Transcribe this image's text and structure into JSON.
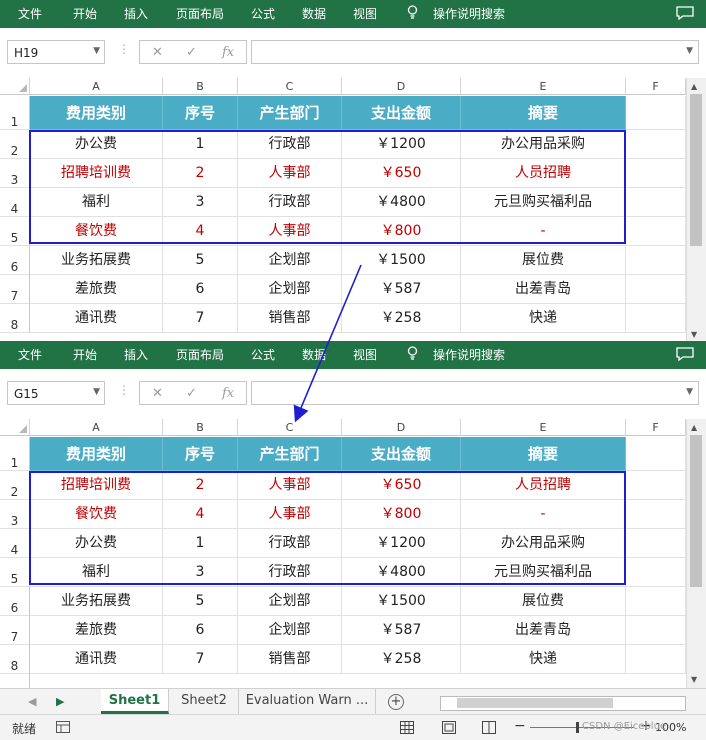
{
  "ribbon": {
    "menu": [
      "文件",
      "开始",
      "插入",
      "页面布局",
      "公式",
      "数据",
      "视图"
    ],
    "tell_me": "操作说明搜索"
  },
  "top_pane": {
    "namebox": "H19",
    "rows": [
      {
        "n": "2",
        "cells": [
          "办公费",
          "1",
          "行政部",
          "￥1200",
          "办公用品采购"
        ],
        "highlight": false
      },
      {
        "n": "3",
        "cells": [
          "招聘培训费",
          "2",
          "人事部",
          "￥650",
          "人员招聘"
        ],
        "highlight": true
      },
      {
        "n": "4",
        "cells": [
          "福利",
          "3",
          "行政部",
          "￥4800",
          "元旦购买福利品"
        ],
        "highlight": false
      },
      {
        "n": "5",
        "cells": [
          "餐饮费",
          "4",
          "人事部",
          "￥800",
          "-"
        ],
        "highlight": true
      },
      {
        "n": "6",
        "cells": [
          "业务拓展费",
          "5",
          "企划部",
          "￥1500",
          "展位费"
        ],
        "highlight": false
      },
      {
        "n": "7",
        "cells": [
          "差旅费",
          "6",
          "企划部",
          "￥587",
          "出差青岛"
        ],
        "highlight": false
      },
      {
        "n": "8",
        "cells": [
          "通讯费",
          "7",
          "销售部",
          "￥258",
          "快递"
        ],
        "highlight": false
      }
    ]
  },
  "bottom_pane": {
    "namebox": "G15",
    "rows": [
      {
        "n": "2",
        "cells": [
          "招聘培训费",
          "2",
          "人事部",
          "￥650",
          "人员招聘"
        ],
        "highlight": true
      },
      {
        "n": "3",
        "cells": [
          "餐饮费",
          "4",
          "人事部",
          "￥800",
          "-"
        ],
        "highlight": true
      },
      {
        "n": "4",
        "cells": [
          "办公费",
          "1",
          "行政部",
          "￥1200",
          "办公用品采购"
        ],
        "highlight": false
      },
      {
        "n": "5",
        "cells": [
          "福利",
          "3",
          "行政部",
          "￥4800",
          "元旦购买福利品"
        ],
        "highlight": false
      },
      {
        "n": "6",
        "cells": [
          "业务拓展费",
          "5",
          "企划部",
          "￥1500",
          "展位费"
        ],
        "highlight": false
      },
      {
        "n": "7",
        "cells": [
          "差旅费",
          "6",
          "企划部",
          "￥587",
          "出差青岛"
        ],
        "highlight": false
      },
      {
        "n": "8",
        "cells": [
          "通讯费",
          "7",
          "销售部",
          "￥258",
          "快递"
        ],
        "highlight": false
      }
    ]
  },
  "columns": [
    "A",
    "B",
    "C",
    "D",
    "E",
    "F"
  ],
  "header_row": {
    "n": "1",
    "cells": [
      "费用类别",
      "序号",
      "产生部门",
      "支出金额",
      "摘要"
    ]
  },
  "fx_label": "fx",
  "tabs": [
    "Sheet1",
    "Sheet2",
    "Evaluation Warn ..."
  ],
  "status": {
    "ready": "就绪",
    "zoom": "100%",
    "watermark": "CSDN @Eiceblue"
  },
  "colors": {
    "ribbon": "#217346",
    "header_fill": "#4bacc6",
    "highlight_text": "#c00000",
    "selection_border": "#1f1fd1"
  }
}
